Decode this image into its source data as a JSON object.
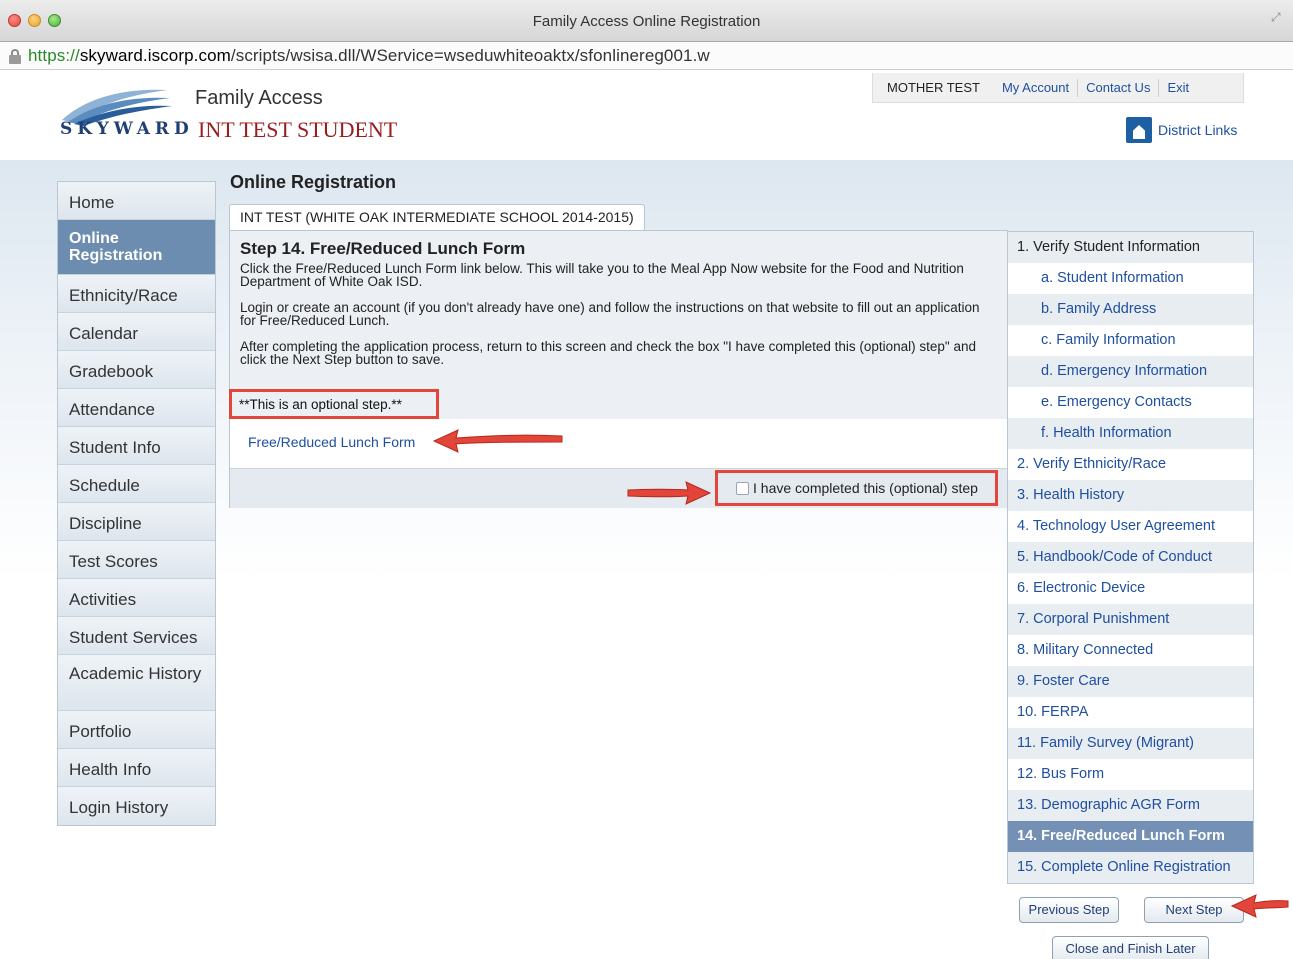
{
  "window": {
    "title": "Family Access Online Registration"
  },
  "url": {
    "scheme": "https://",
    "host": "skyward.iscorp.com",
    "path": "/scripts/wsisa.dll/WService=wseduwhiteoaktx/sfonlinereg001.w"
  },
  "header": {
    "logo_text": "SKYWARD",
    "app_name": "Family Access",
    "student_name": "INT TEST STUDENT",
    "user_name": "MOTHER TEST",
    "links": {
      "my_account": "My Account",
      "contact_us": "Contact Us",
      "exit": "Exit"
    },
    "district_links": "District Links"
  },
  "sidebar": {
    "items": [
      {
        "label": "Home"
      },
      {
        "label": "Online Registration",
        "active": true
      },
      {
        "label": "Ethnicity/Race"
      },
      {
        "label": "Calendar"
      },
      {
        "label": "Gradebook"
      },
      {
        "label": "Attendance"
      },
      {
        "label": "Student Info"
      },
      {
        "label": "Schedule"
      },
      {
        "label": "Discipline"
      },
      {
        "label": "Test Scores"
      },
      {
        "label": "Activities"
      },
      {
        "label": "Student Services"
      },
      {
        "label": "Academic History"
      },
      {
        "label": "Portfolio"
      },
      {
        "label": "Health Info"
      },
      {
        "label": "Login History"
      }
    ]
  },
  "content": {
    "section_title": "Online Registration",
    "tab_label": "INT TEST (WHITE OAK INTERMEDIATE SCHOOL 2014-2015)",
    "step_title": "Step 14. Free/Reduced Lunch Form",
    "paragraphs": [
      "Click the Free/Reduced Lunch Form link below. This will take you to the Meal App Now website for the Food and Nutrition Department of White Oak ISD.",
      "Login or create an account (if you don't already have one) and follow the instructions on that website to fill out an application for Free/Reduced Lunch.",
      "After completing the application process, return to this screen and check the box \"I have completed this (optional) step\" and click the Next Step button to save."
    ],
    "optional_note": "**This is an optional step.**",
    "lunch_link": "Free/Reduced Lunch Form",
    "checkbox_label": "I have completed this (optional) step",
    "checkbox_checked": false
  },
  "steps": [
    {
      "label": "1. Verify Student Information",
      "level": 0
    },
    {
      "label": "a. Student Information",
      "level": 1
    },
    {
      "label": "b. Family Address",
      "level": 1
    },
    {
      "label": "c. Family Information",
      "level": 1
    },
    {
      "label": "d. Emergency Information",
      "level": 1
    },
    {
      "label": "e. Emergency Contacts",
      "level": 1
    },
    {
      "label": "f. Health Information",
      "level": 1
    },
    {
      "label": "2. Verify Ethnicity/Race",
      "level": 0
    },
    {
      "label": "3. Health History",
      "level": 0
    },
    {
      "label": "4. Technology User Agreement",
      "level": 0
    },
    {
      "label": "5. Handbook/Code of Conduct",
      "level": 0
    },
    {
      "label": "6. Electronic Device",
      "level": 0
    },
    {
      "label": "7. Corporal Punishment",
      "level": 0
    },
    {
      "label": "8. Military Connected",
      "level": 0
    },
    {
      "label": "9. Foster Care",
      "level": 0
    },
    {
      "label": "10. FERPA",
      "level": 0
    },
    {
      "label": "11. Family Survey (Migrant)",
      "level": 0
    },
    {
      "label": "12. Bus Form",
      "level": 0
    },
    {
      "label": "13. Demographic AGR Form",
      "level": 0
    },
    {
      "label": "14. Free/Reduced Lunch Form",
      "level": 0,
      "current": true
    },
    {
      "label": "15. Complete Online Registration",
      "level": 0
    }
  ],
  "buttons": {
    "previous": "Previous Step",
    "next": "Next Step",
    "close": "Close and Finish Later"
  },
  "colors": {
    "highlight_red": "#e2463a",
    "link_blue": "#1f4fa0",
    "active_nav": "#6d8db0",
    "student_name": "#9b1c1c"
  }
}
